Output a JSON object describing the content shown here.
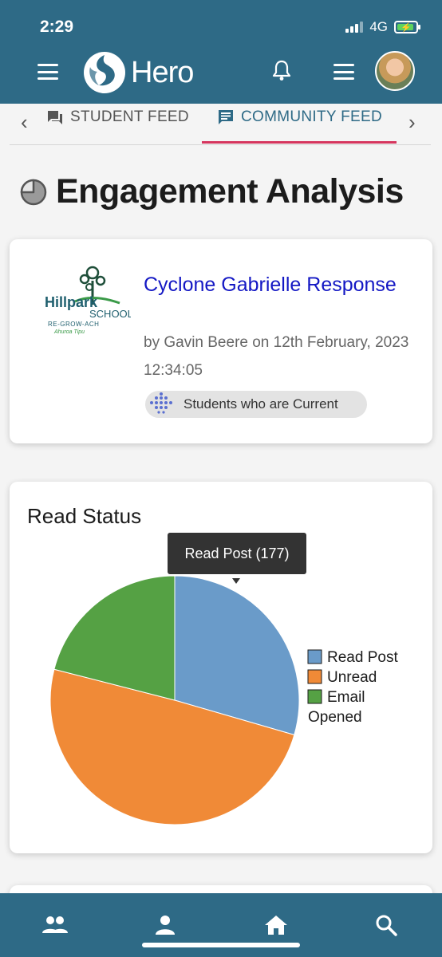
{
  "status_bar": {
    "time": "2:29",
    "network": "4G"
  },
  "header": {
    "app_name": "Hero",
    "brand_color": "#2e6a86"
  },
  "tabs": [
    {
      "label": "STUDENT FEED",
      "icon": "chat-icon",
      "active": false
    },
    {
      "label": "COMMUNITY FEED",
      "icon": "feed-icon",
      "active": true
    }
  ],
  "page": {
    "title": "Engagement Analysis",
    "icon": "pie-chart-icon"
  },
  "post": {
    "title": "Cyclone Gabrielle Response",
    "meta": "by Gavin Beere on 12th February, 2023 12:34:05",
    "audience": "Students who are Current",
    "school_logo": {
      "name": "Hillpark",
      "school": "SCHOOL",
      "motto": "RE-GROW-ACH",
      "subtitle": "Ahuroa Tipu"
    }
  },
  "chart_data": {
    "type": "pie",
    "title": "Read Status",
    "slices": [
      {
        "label": "Read Post",
        "value": 177,
        "color": "#6a9bc9"
      },
      {
        "label": "Unread",
        "value": 297,
        "color": "#f08a37"
      },
      {
        "label": "Email Opened",
        "value": 126,
        "color": "#55a144"
      }
    ],
    "tooltip": "Read Post (177)",
    "legend_position": "right"
  },
  "bottom_nav": [
    "people-icon",
    "person-icon",
    "home-icon",
    "search-icon"
  ]
}
